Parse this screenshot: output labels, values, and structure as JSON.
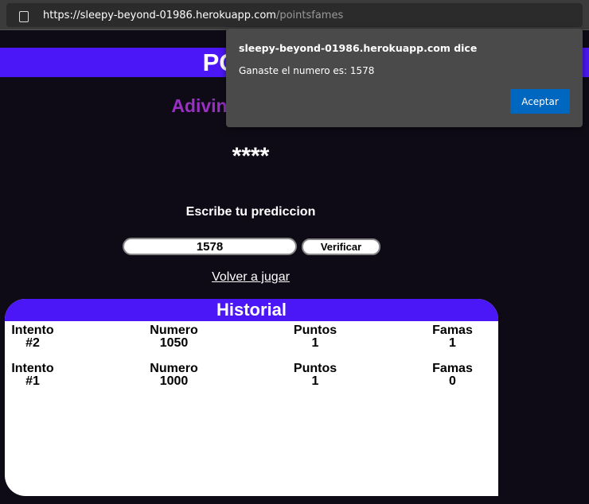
{
  "browser": {
    "url_host": "https://sleepy-beyond-01986.herokuapp.com",
    "url_path": "/pointsfames"
  },
  "header": {
    "title": "POINTS FAMES"
  },
  "subtitle": "Adivina el numero",
  "hidden_number": "****",
  "prompt": "Escribe tu prediccion",
  "guess_input": "1578",
  "verify_label": "Verificar",
  "replay_link": "Volver a jugar",
  "history": {
    "title": "Historial",
    "headers": [
      "Intento",
      "Numero",
      "Puntos",
      "Famas"
    ],
    "rows": [
      [
        "#2",
        "1050",
        "1",
        "1"
      ],
      [
        "#1",
        "1000",
        "1",
        "0"
      ]
    ]
  },
  "dialog": {
    "title": "sleepy-beyond-01986.herokuapp.com dice",
    "message": "Ganaste el numero es: 1578",
    "ok": "Aceptar"
  }
}
